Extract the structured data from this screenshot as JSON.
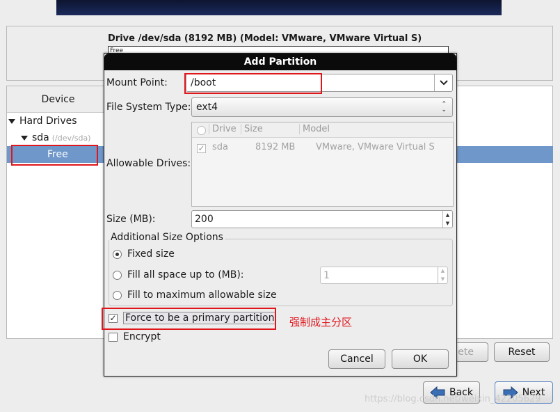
{
  "drive": {
    "title": "Drive /dev/sda (8192 MB) (Model: VMware, VMware Virtual S)",
    "bar_label": "Free"
  },
  "tree": {
    "column_header": "Device",
    "hard_drives": "Hard Drives",
    "sda": "sda",
    "sda_path": "(/dev/sda)",
    "free": "Free"
  },
  "main_buttons": {
    "delete": "Delete",
    "delete_visible": "lete",
    "reset": "Reset",
    "back": "Back",
    "next": "Next"
  },
  "dialog": {
    "title": "Add Partition",
    "mount_point_label": "Mount Point:",
    "mount_point_value": "/boot",
    "fs_type_label": "File System Type:",
    "fs_type_value": "ext4",
    "allowable_drives_label": "Allowable Drives:",
    "drive_columns": [
      "Drive",
      "Size",
      "Model"
    ],
    "drive_rows": [
      {
        "drive": "sda",
        "size": "8192 MB",
        "model": "VMware, VMware Virtual S",
        "checked": true
      }
    ],
    "size_label": "Size (MB):",
    "size_value": "200",
    "additional_size_options_label": "Additional Size Options",
    "opt_fixed": "Fixed size",
    "opt_fill_up_to": "Fill all space up to (MB):",
    "fill_up_to_value": "1",
    "opt_fill_max": "Fill to maximum allowable size",
    "force_primary": "Force to be a primary partition",
    "encrypt": "Encrypt",
    "cancel": "Cancel",
    "ok": "OK"
  },
  "annotation": {
    "force_primary_note": "强制成主分区"
  },
  "watermark": "https://blog.csdn.net/weixin_42205629",
  "colors": {
    "selection": "#6f97c9",
    "highlight_box": "#e0161d",
    "dialog_title_bg": "#0b0b0b"
  }
}
